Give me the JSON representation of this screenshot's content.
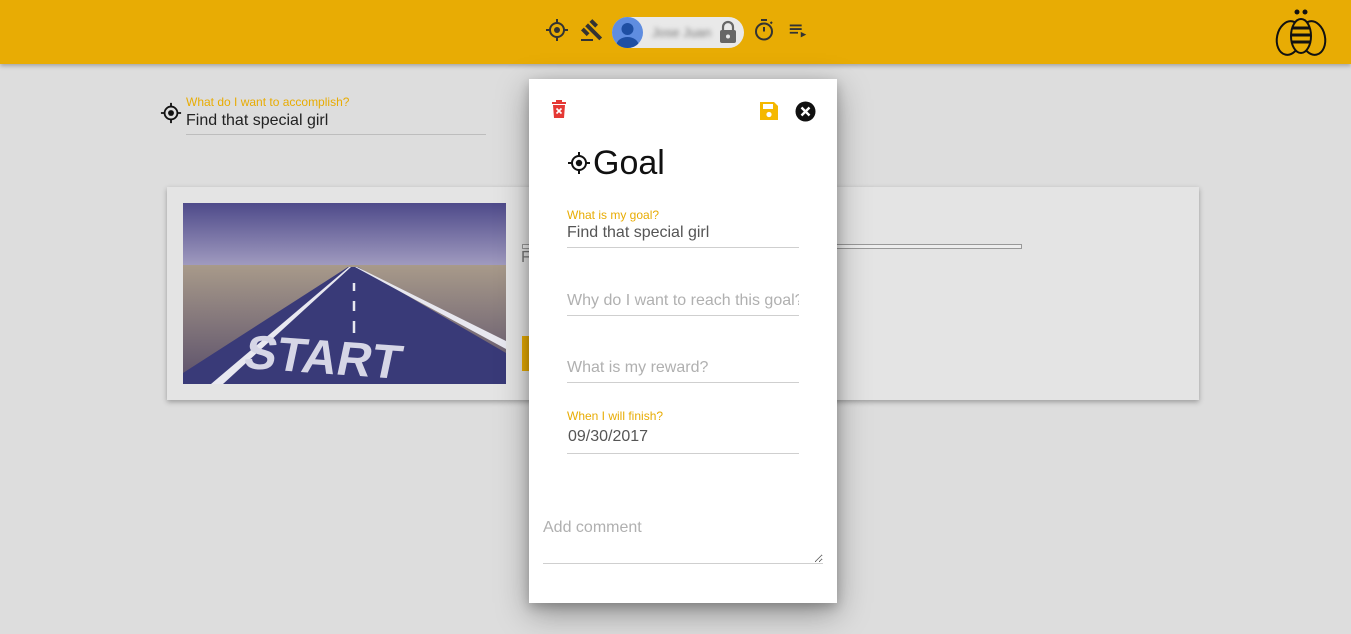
{
  "header": {
    "user_name": "Jose Juan",
    "icons": [
      "goal-target-icon",
      "gavel-icon",
      "user-avatar-icon",
      "lock-icon",
      "timer-icon",
      "playlist-icon",
      "bee-logo-icon"
    ],
    "colors": {
      "brand": "#e8ac04"
    }
  },
  "background": {
    "goal_field": {
      "label": "What do I want to accomplish?",
      "value": "Find that special girl"
    },
    "card": {
      "image_text": "START",
      "partial_text": "F"
    }
  },
  "dialog": {
    "title": "Goal",
    "fields": {
      "goal": {
        "label": "What is my goal?",
        "value": "Find that special girl"
      },
      "why": {
        "placeholder": "Why do I want to reach this goal?"
      },
      "reward": {
        "placeholder": "What is my reward?"
      },
      "finish": {
        "label": "When I will finish?",
        "value": "09/30/2017"
      }
    },
    "comment_placeholder": "Add comment",
    "colors": {
      "delete": "#e53935",
      "save": "#f5b800",
      "close": "#111111"
    }
  }
}
